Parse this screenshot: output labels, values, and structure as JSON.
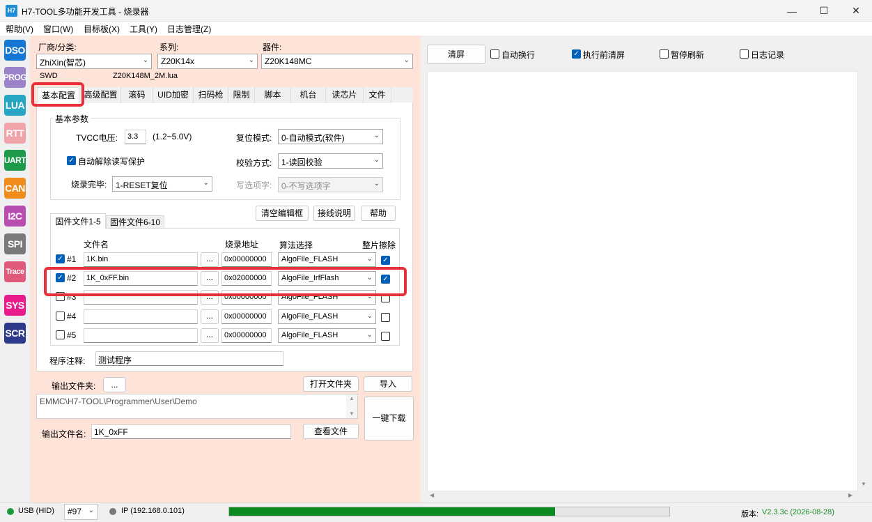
{
  "window": {
    "app_icon": "H7",
    "title": "H7-TOOL多功能开发工具 - 烧录器"
  },
  "menu": [
    "帮助(V)",
    "窗口(W)",
    "目标板(X)",
    "工具(Y)",
    "日志管理(Z)"
  ],
  "sidebar": [
    {
      "label": "DSO",
      "color": "#1677d2"
    },
    {
      "label": "PROG",
      "color": "#9b82c9"
    },
    {
      "label": "LUA",
      "color": "#26a5c5"
    },
    {
      "label": "RTT",
      "color": "#f0a3a9"
    },
    {
      "label": "UART",
      "color": "#1f9a4a"
    },
    {
      "label": "CAN",
      "color": "#f08c1c"
    },
    {
      "label": "I2C",
      "color": "#b84fb0"
    },
    {
      "label": "SPI",
      "color": "#7a7a7a"
    },
    {
      "label": "Trace",
      "color": "#e05a7a"
    },
    {
      "label": "SYS",
      "color": "#e81c8c"
    },
    {
      "label": "SCR",
      "color": "#2d3a8c"
    }
  ],
  "device": {
    "vendor_label": "厂商/分类:",
    "vendor_value": "ZhiXin(智芯)",
    "series_label": "系列:",
    "series_value": "Z20K14x",
    "chip_label": "器件:",
    "chip_value": "Z20K148MC",
    "interface": "SWD",
    "lua_file": "Z20K148M_2M.lua"
  },
  "tabs": [
    "基本配置",
    "高级配置",
    "滚码",
    "UID加密",
    "扫码枪",
    "限制",
    "脚本",
    "机台",
    "读芯片",
    "文件"
  ],
  "basic": {
    "group_title": "基本参数",
    "tvcc_label": "TVCC电压:",
    "tvcc_value": "3.3",
    "tvcc_range": "(1.2~5.0V)",
    "reset_label": "复位模式:",
    "reset_value": "0-自动模式(软件)",
    "auto_unprotect_label": "自动解除读写保护",
    "verify_label": "校验方式:",
    "verify_value": "1-读回校验",
    "finish_label": "烧录完毕:",
    "finish_value": "1-RESET复位",
    "option_label": "写选项字:",
    "option_value": "0-不写选项字",
    "btn_clear": "清空编辑框",
    "btn_wiring": "接线说明",
    "btn_help": "帮助"
  },
  "file_tabs": [
    "固件文件1-5",
    "固件文件6-10"
  ],
  "file_table": {
    "headers": {
      "name": "文件名",
      "addr": "烧录地址",
      "algo": "算法选择",
      "erase": "整片擦除"
    },
    "browse": "...",
    "rows": [
      {
        "idx": "#1",
        "checked": true,
        "name": "1K.bin",
        "addr": "0x00000000",
        "algo": "AlgoFile_FLASH",
        "erase": true
      },
      {
        "idx": "#2",
        "checked": true,
        "name": "1K_0xFF.bin",
        "addr": "0x02000000",
        "algo": "AlgoFile_IrfFlash",
        "erase": true
      },
      {
        "idx": "#3",
        "checked": false,
        "name": "",
        "addr": "0x00000000",
        "algo": "AlgoFile_FLASH",
        "erase": false
      },
      {
        "idx": "#4",
        "checked": false,
        "name": "",
        "addr": "0x00000000",
        "algo": "AlgoFile_FLASH",
        "erase": false
      },
      {
        "idx": "#5",
        "checked": false,
        "name": "",
        "addr": "0x00000000",
        "algo": "AlgoFile_FLASH",
        "erase": false
      }
    ]
  },
  "note": {
    "label": "程序注释:",
    "value": "测试程序"
  },
  "output": {
    "folder_label": "输出文件夹:",
    "folder_btn": "...",
    "open_folder_btn": "打开文件夹",
    "import_btn": "导入",
    "path": "EMMC\\H7-TOOL\\Programmer\\User\\Demo",
    "download_btn": "一键下载",
    "filename_label": "输出文件名:",
    "filename_value": "1K_0xFF",
    "view_btn": "查看文件"
  },
  "right": {
    "clear_btn": "清屏",
    "auto_wrap": "自动换行",
    "auto_wrap_checked": false,
    "clear_before": "执行前清屏",
    "clear_before_checked": true,
    "pause": "暂停刷新",
    "pause_checked": false,
    "log": "日志记录",
    "log_checked": false
  },
  "status": {
    "usb": "USB (HID)",
    "usb_color": "#1a9a3a",
    "device_no": "#97",
    "ip": "IP (192.168.0.101)",
    "ip_color": "#777777",
    "progress": 0.74,
    "progress_color": "#0b8a1f",
    "version_label": "版本:",
    "version_value": "V2.3.3c (2026-08-28)",
    "version_color": "#1a8a2a"
  }
}
